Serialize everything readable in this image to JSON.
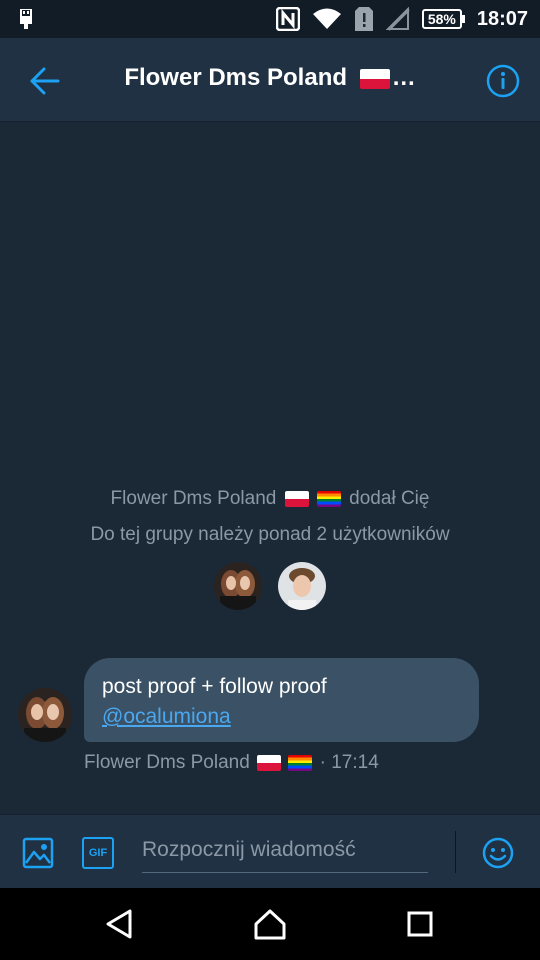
{
  "status_bar": {
    "battery": "58%",
    "time": "18:07",
    "icons": [
      "usb-icon",
      "nfc-icon",
      "wifi-icon",
      "sim-alert-icon",
      "signal-icon",
      "battery-icon"
    ]
  },
  "header": {
    "title": "Flower Dms Poland",
    "title_suffix": "…",
    "flag": "poland-flag",
    "back_icon": "arrow-left-icon",
    "info_icon": "info-icon",
    "accent_color": "#1da1f2"
  },
  "conversation": {
    "system_message": {
      "group_name": "Flower Dms Poland",
      "added_text": "dodał Cię",
      "members_text": "Do tej grupy należy ponad 2 użytkowników"
    },
    "messages": [
      {
        "text": "post proof + follow proof",
        "mention": "@ocalumiona",
        "sender": "Flower Dms Poland",
        "separator": "·",
        "time": "17:14"
      }
    ]
  },
  "composer": {
    "placeholder": "Rozpocznij wiadomość",
    "gif_label": "GIF",
    "media_icon": "image-icon",
    "emoji_icon": "smiley-icon"
  },
  "nav_bar": {
    "icons": [
      "back-triangle-icon",
      "home-icon",
      "recents-icon"
    ]
  }
}
